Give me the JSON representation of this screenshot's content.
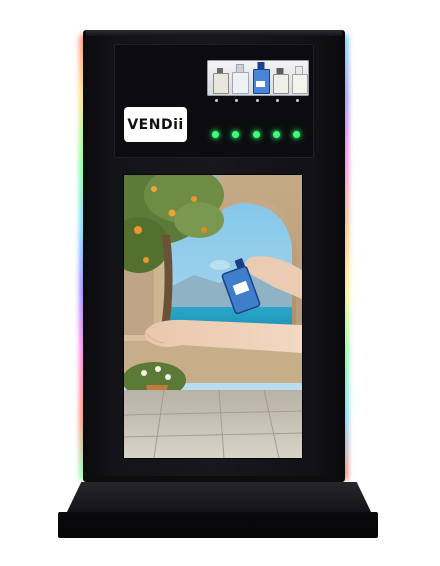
{
  "kiosk": {
    "brand_logo": "VENDii",
    "bottle_count": 5,
    "indicator_led_color": "#3dff7a",
    "cabinet_color": "#141419",
    "glow": "rgb-gradient"
  },
  "screen": {
    "scene": "perfume-spray-advertisement"
  },
  "icons": [
    "perfume-bottle-icon",
    "status-led-icon"
  ]
}
